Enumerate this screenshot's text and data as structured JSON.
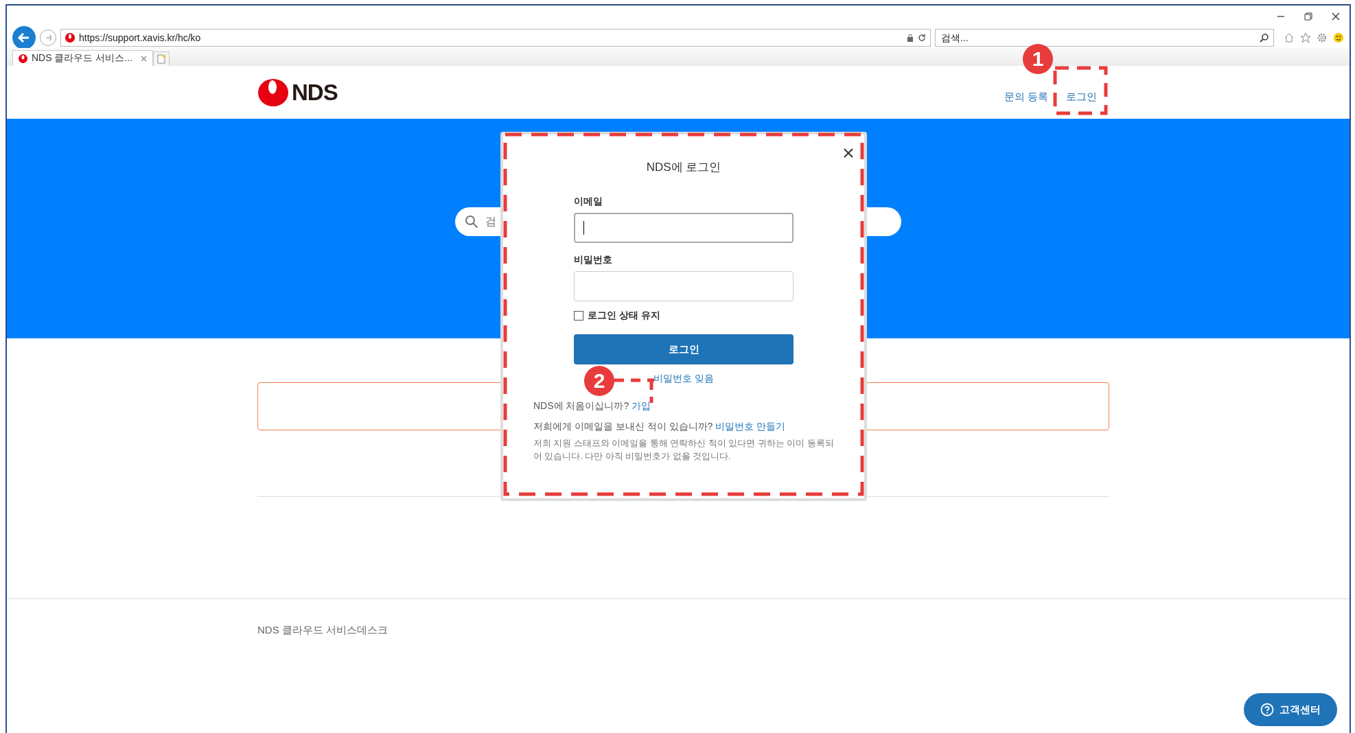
{
  "browser": {
    "url": "https://support.xavis.kr/hc/ko",
    "search_placeholder": "검색...",
    "tab": {
      "title": "NDS 클라우드 서비스..."
    }
  },
  "header": {
    "logo": "NDS",
    "nav": [
      {
        "label": "문의 등록"
      },
      {
        "label": "로그인"
      }
    ]
  },
  "hero": {
    "search_placeholder": "검"
  },
  "modal": {
    "title": "NDS에 로그인",
    "fields": [
      {
        "label": "이메일",
        "focused": true
      },
      {
        "label": "비밀번호",
        "focused": false
      }
    ],
    "remember": {
      "label": "로그인 상태 유지",
      "checked": false
    },
    "submit": "로그인",
    "forgot": "비밀번호 잊음",
    "signup": {
      "text": "NDS에 처음이십니까?",
      "link": "가입"
    },
    "create": {
      "text": "저희에게 이메일을 보내신 적이 있습니까?",
      "link": "비밀번호 만들기"
    },
    "note": "저희 지원 스태프와 이메일을 통해 연락하신 적이 있다면 귀하는 이미 등록되어 있습니다. 다만 아직 비밀번호가 없을 것입니다."
  },
  "footer": {
    "text": "NDS 클라우드 서비스데스크"
  },
  "help_button": {
    "label": "고객센터"
  },
  "annotations": [
    {
      "number": "1"
    },
    {
      "number": "2"
    }
  ]
}
